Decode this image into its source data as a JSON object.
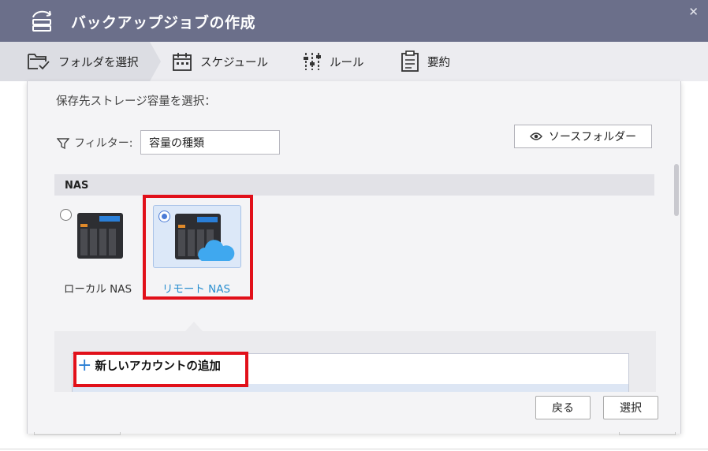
{
  "window": {
    "title": "バックアップジョブの作成",
    "close_glyph": "✕"
  },
  "steps": [
    {
      "label": "フォルダを選択",
      "icon": "folder-check-icon",
      "active": true
    },
    {
      "label": "スケジュール",
      "icon": "calendar-icon",
      "active": false
    },
    {
      "label": "ルール",
      "icon": "sliders-icon",
      "active": false
    },
    {
      "label": "要約",
      "icon": "clipboard-icon",
      "active": false
    }
  ],
  "content": {
    "prompt": "保存先ストレージ容量を選択：",
    "filter_label": "フィルター:",
    "filter_value": "容量の種類",
    "source_folder_button": "ソースフォルダー",
    "section_header": "NAS"
  },
  "nas_options": [
    {
      "label": "ローカル NAS",
      "selected": false,
      "icon": "nas-device-icon"
    },
    {
      "label": "リモート NAS",
      "selected": true,
      "icon": "nas-cloud-icon"
    }
  ],
  "accounts": {
    "add_label": "新しいアカウントの追加",
    "add_icon": "plus-icon"
  },
  "footer": {
    "back_button": "戻る",
    "select_button": "選択"
  },
  "colors": {
    "titlebar": "#6b6f8a",
    "highlight": "#e1101a",
    "accent": "#2b8fd0"
  }
}
